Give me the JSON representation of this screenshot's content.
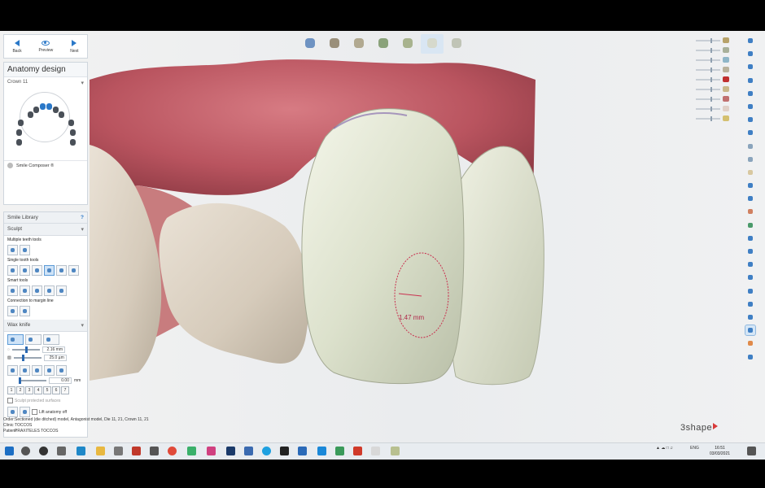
{
  "nav": {
    "back": "Back",
    "preview": "Preview",
    "next": "Next"
  },
  "anatomy": {
    "title": "Anatomy design",
    "crown": "Crown 11",
    "smile_composer": "Smile Composer ®"
  },
  "sculpt_panel": {
    "smile_library": "Smile Library",
    "help": "?",
    "sculpt": "Sculpt",
    "multiple_teeth_tools": "Multiple teeth tools",
    "single_tooth_tools": "Single tooth tools",
    "smart_tools": "Smart tools",
    "connection_margin": "Connection to margin line",
    "wax_knife": "Wax knife",
    "size_value": "2.16 mm",
    "depth_value": "25.0 µm",
    "smooth_value": "0.00",
    "smooth_unit": "mm",
    "number_buttons": [
      "1",
      "2",
      "3",
      "4",
      "5",
      "6",
      "7"
    ],
    "sculpt_protected": "Sculpt protected surfaces",
    "lift_anatomy": "Lift anatomy off"
  },
  "order_info": {
    "order_label": "Order:",
    "order_value": "Sectioned (die ditched) model, Antagonist model, Die 11, 21, Crown 11, 21",
    "clinic_label": "Clinic:",
    "clinic_value": "TOCCOS",
    "patient_label": "Patient:",
    "patient_value": "PRAXITELES TOCCOS"
  },
  "measurement": "1.47 mm",
  "brand": "3shape",
  "taskbar": {
    "lang": "ENG",
    "time": "16:51",
    "date": "03/03/2021"
  },
  "colors": {
    "accent": "#2a78c8",
    "brand_red": "#d83a3a",
    "measure": "#b0284a",
    "gum": "#c0606a",
    "crown": "#dfe3d2"
  }
}
